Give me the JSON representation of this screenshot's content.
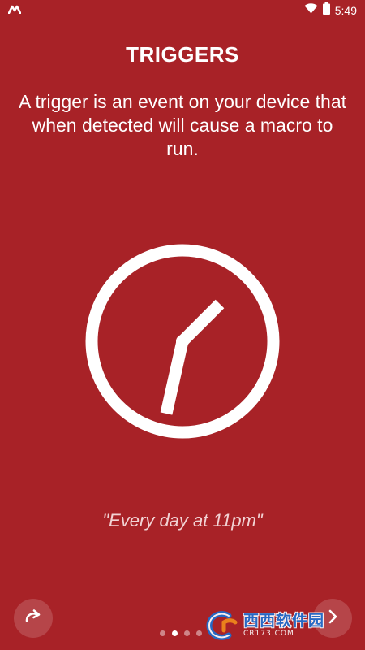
{
  "status_bar": {
    "time": "5:49",
    "app_icon": "macrodroid-m-icon",
    "wifi_icon": "wifi-icon",
    "battery_icon": "battery-icon"
  },
  "slide": {
    "title": "TRIGGERS",
    "description": "A trigger is an event on your device that when detected will cause a macro to run.",
    "illustration_icon": "clock-icon",
    "example": "\"Every day at 11pm\""
  },
  "navigation": {
    "skip_icon": "redo-arrow-icon",
    "next_icon": "chevron-right-icon",
    "dots_total": 4,
    "active_dot": 2
  },
  "watermark": {
    "brand_text": "西西软件园",
    "site_text": "CR173.COM"
  },
  "colors": {
    "background": "#A82227",
    "foreground": "#FFFFFF"
  }
}
